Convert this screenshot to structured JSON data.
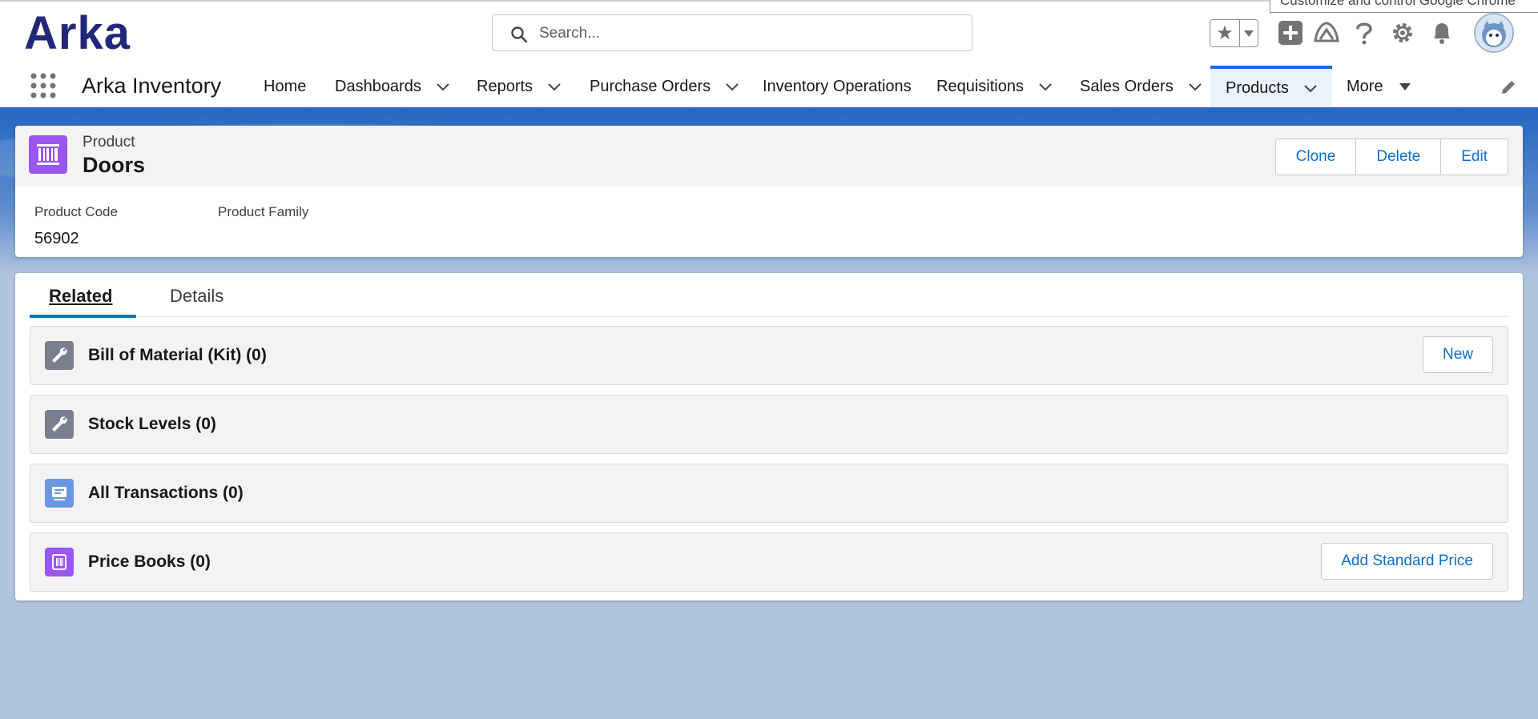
{
  "browser": {
    "tooltip": "Customize and control Google Chrome"
  },
  "header": {
    "logo": "Arka",
    "search_placeholder": "Search...",
    "icons": [
      "star-icon",
      "chevron-down-icon",
      "add-icon",
      "trailhead-icon",
      "help-icon",
      "gear-icon",
      "bell-icon",
      "avatar"
    ]
  },
  "nav": {
    "app_name": "Arka Inventory",
    "items": [
      {
        "label": "Home",
        "dropdown": false
      },
      {
        "label": "Dashboards",
        "dropdown": true
      },
      {
        "label": "Reports",
        "dropdown": true
      },
      {
        "label": "Purchase Orders",
        "dropdown": true
      },
      {
        "label": "Inventory Operations",
        "dropdown": false
      },
      {
        "label": "Requisitions",
        "dropdown": true
      },
      {
        "label": "Sales Orders",
        "dropdown": true
      },
      {
        "label": "Products",
        "dropdown": true,
        "active": true
      },
      {
        "label": "More",
        "dropdown": true
      }
    ]
  },
  "record": {
    "object": "Product",
    "name": "Doors",
    "actions": [
      "Clone",
      "Delete",
      "Edit"
    ],
    "fields": [
      {
        "label": "Product Code",
        "value": "56902"
      },
      {
        "label": "Product Family",
        "value": ""
      }
    ]
  },
  "tabs": [
    {
      "label": "Related",
      "active": true
    },
    {
      "label": "Details",
      "active": false
    }
  ],
  "related_lists": [
    {
      "title": "Bill of Material (Kit) (0)",
      "icon": "wrench-icon",
      "button": "New"
    },
    {
      "title": "Stock Levels (0)",
      "icon": "wrench-icon",
      "button": ""
    },
    {
      "title": "All Transactions (0)",
      "icon": "transactions-icon",
      "button": ""
    },
    {
      "title": "Price Books (0)",
      "icon": "pricebook-icon",
      "button": "Add Standard Price"
    }
  ],
  "colors": {
    "brand": "#23277a",
    "accent": "#0b6fe0",
    "link": "#0b6ed0",
    "product_icon": "#9b55f0",
    "wrench_icon": "#7a7e8f",
    "transactions_icon": "#6b96e3"
  }
}
